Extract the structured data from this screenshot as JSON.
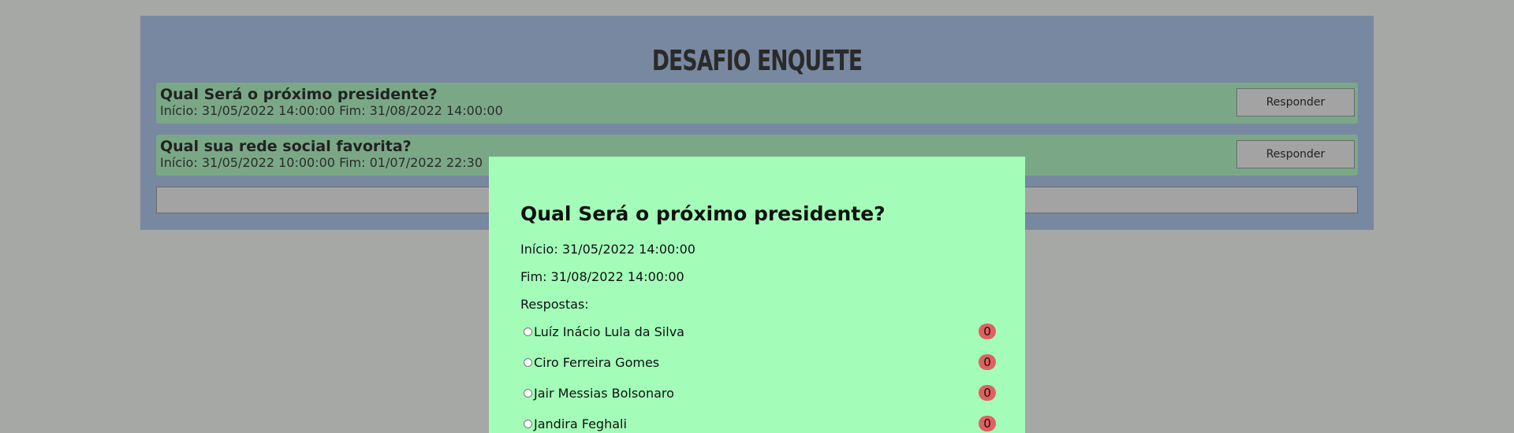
{
  "app": {
    "title": "DESAFIO ENQUETE"
  },
  "polls": [
    {
      "title": "Qual Será o próximo presidente?",
      "dates": "Início: 31/05/2022 14:00:00 Fim: 31/08/2022 14:00:00",
      "button_label": "Responder"
    },
    {
      "title": "Qual sua rede social favorita?",
      "dates": "Início: 31/05/2022 10:00:00 Fim: 01/07/2022 22:30",
      "button_label": "Responder"
    }
  ],
  "modal": {
    "title": "Qual Será o próximo presidente?",
    "start": "Início: 31/05/2022 14:00:00",
    "end": "Fim: 31/08/2022 14:00:00",
    "answers_label": "Respostas:",
    "options": [
      {
        "label": "Luíz Inácio Lula da Silva",
        "votes": "0"
      },
      {
        "label": "Ciro Ferreira Gomes",
        "votes": "0"
      },
      {
        "label": "Jair Messias Bolsonaro",
        "votes": "0"
      },
      {
        "label": "Jandira Feghali",
        "votes": "0"
      }
    ]
  },
  "colors": {
    "background": "#a6a8a6",
    "panel": "#7888a0",
    "card": "#7aa887",
    "modal": "#a3fdb9",
    "vote_badge": "#e06060"
  }
}
